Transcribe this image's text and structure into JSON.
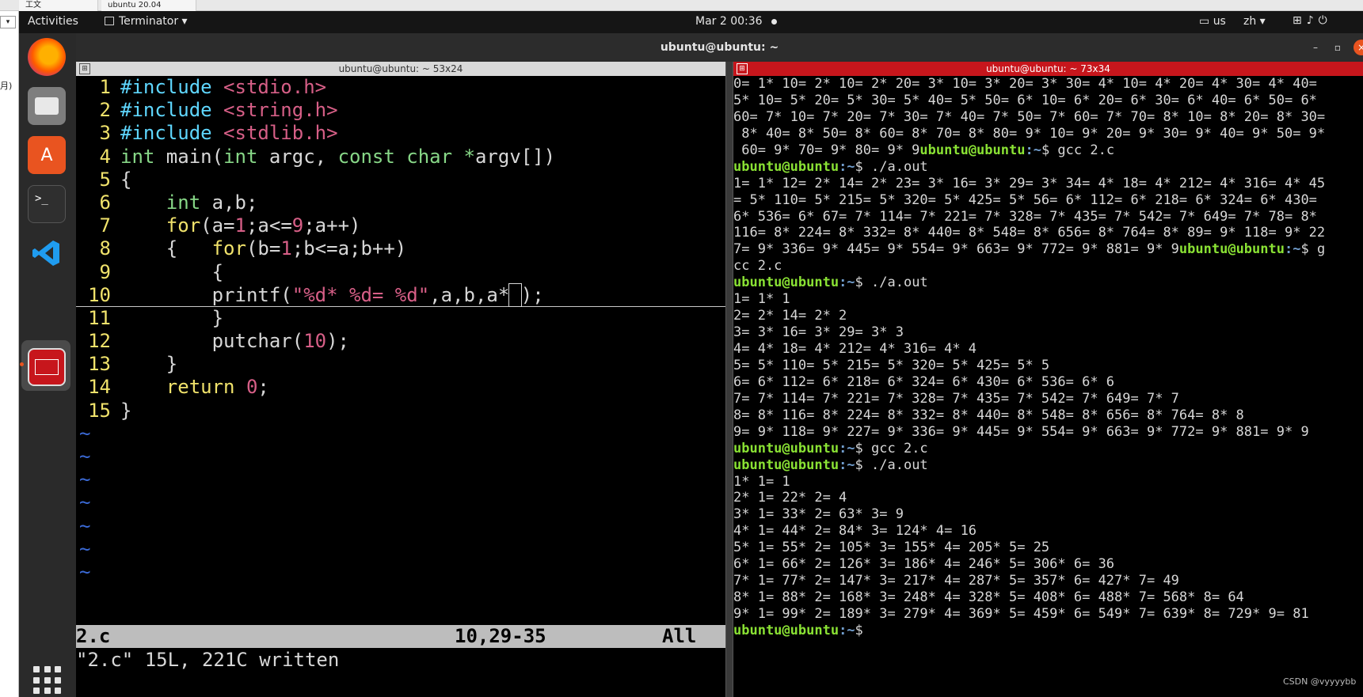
{
  "host": {
    "tab1": "工文",
    "tab2": "ubuntu 20.04",
    "dropdown": "▾",
    "side_label": "月)"
  },
  "topbar": {
    "activities": "Activities",
    "app_menu": "Terminator ▾",
    "clock": "Mar 2  00:36",
    "keyboard": "us",
    "input_method": "zh ▾"
  },
  "window": {
    "title": "ubuntu@ubuntu: ~"
  },
  "left_pane": {
    "title": "ubuntu@ubuntu: ~ 53x24",
    "status_file": "2.c",
    "status_pos": "10,29-35",
    "status_all": "All",
    "cmdline": "\"2.c\" 15L, 221C written"
  },
  "right_pane": {
    "title": "ubuntu@ubuntu: ~ 73x34",
    "lines": [
      {
        "text": "0= 1* 10= 2* 10= 2* 20= 3* 10= 3* 20= 3* 30= 4* 10= 4* 20= 4* 30= 4* 40="
      },
      {
        "text": "5* 10= 5* 20= 5* 30= 5* 40= 5* 50= 6* 10= 6* 20= 6* 30= 6* 40= 6* 50= 6*"
      },
      {
        "text": "60= 7* 10= 7* 20= 7* 30= 7* 40= 7* 50= 7* 60= 7* 70= 8* 10= 8* 20= 8* 30="
      },
      {
        "text": " 8* 40= 8* 50= 8* 60= 8* 70= 8* 80= 9* 10= 9* 20= 9* 30= 9* 40= 9* 50= 9*"
      },
      {
        "pre": " 60= 9* 70= 9* 80= 9* 9",
        "user": "ubuntu@ubuntu",
        "path": ":~",
        "cmd": "$ gcc 2.c"
      },
      {
        "user": "ubuntu@ubuntu",
        "path": ":~",
        "cmd": "$ ./a.out"
      },
      {
        "text": "1= 1* 12= 2* 14= 2* 23= 3* 16= 3* 29= 3* 34= 4* 18= 4* 212= 4* 316= 4* 45"
      },
      {
        "text": "= 5* 110= 5* 215= 5* 320= 5* 425= 5* 56= 6* 112= 6* 218= 6* 324= 6* 430="
      },
      {
        "text": "6* 536= 6* 67= 7* 114= 7* 221= 7* 328= 7* 435= 7* 542= 7* 649= 7* 78= 8*"
      },
      {
        "text": "116= 8* 224= 8* 332= 8* 440= 8* 548= 8* 656= 8* 764= 8* 89= 9* 118= 9* 22"
      },
      {
        "pre": "7= 9* 336= 9* 445= 9* 554= 9* 663= 9* 772= 9* 881= 9* 9",
        "user": "ubuntu@ubuntu",
        "path": ":~",
        "cmd": "$ g"
      },
      {
        "text": "cc 2.c"
      },
      {
        "user": "ubuntu@ubuntu",
        "path": ":~",
        "cmd": "$ ./a.out"
      },
      {
        "text": "1= 1* 1"
      },
      {
        "text": "2= 2* 14= 2* 2"
      },
      {
        "text": "3= 3* 16= 3* 29= 3* 3"
      },
      {
        "text": "4= 4* 18= 4* 212= 4* 316= 4* 4"
      },
      {
        "text": "5= 5* 110= 5* 215= 5* 320= 5* 425= 5* 5"
      },
      {
        "text": "6= 6* 112= 6* 218= 6* 324= 6* 430= 6* 536= 6* 6"
      },
      {
        "text": "7= 7* 114= 7* 221= 7* 328= 7* 435= 7* 542= 7* 649= 7* 7"
      },
      {
        "text": "8= 8* 116= 8* 224= 8* 332= 8* 440= 8* 548= 8* 656= 8* 764= 8* 8"
      },
      {
        "text": "9= 9* 118= 9* 227= 9* 336= 9* 445= 9* 554= 9* 663= 9* 772= 9* 881= 9* 9"
      },
      {
        "user": "ubuntu@ubuntu",
        "path": ":~",
        "cmd": "$ gcc 2.c"
      },
      {
        "user": "ubuntu@ubuntu",
        "path": ":~",
        "cmd": "$ ./a.out"
      },
      {
        "text": "1* 1= 1"
      },
      {
        "text": "2* 1= 22* 2= 4"
      },
      {
        "text": "3* 1= 33* 2= 63* 3= 9"
      },
      {
        "text": "4* 1= 44* 2= 84* 3= 124* 4= 16"
      },
      {
        "text": "5* 1= 55* 2= 105* 3= 155* 4= 205* 5= 25"
      },
      {
        "text": "6* 1= 66* 2= 126* 3= 186* 4= 246* 5= 306* 6= 36"
      },
      {
        "text": "7* 1= 77* 2= 147* 3= 217* 4= 287* 5= 357* 6= 427* 7= 49"
      },
      {
        "text": "8* 1= 88* 2= 168* 3= 248* 4= 328* 5= 408* 6= 488* 7= 568* 8= 64"
      },
      {
        "text": "9* 1= 99* 2= 189* 3= 279* 4= 369* 5= 459* 6= 549* 7= 639* 8= 729* 9= 81"
      },
      {
        "user": "ubuntu@ubuntu",
        "path": ":~",
        "cmd": "$ "
      }
    ]
  },
  "code": [
    {
      "n": "1",
      "parts": [
        [
          "pre",
          "#include "
        ],
        [
          "ang",
          "<stdio.h>"
        ]
      ]
    },
    {
      "n": "2",
      "parts": [
        [
          "pre",
          "#include "
        ],
        [
          "ang",
          "<string.h>"
        ]
      ]
    },
    {
      "n": "3",
      "parts": [
        [
          "pre",
          "#include "
        ],
        [
          "ang",
          "<stdlib.h>"
        ]
      ]
    },
    {
      "n": "4",
      "parts": [
        [
          "ty",
          "int"
        ],
        [
          "pl",
          " main("
        ],
        [
          "ty",
          "int"
        ],
        [
          "pl",
          " argc, "
        ],
        [
          "ty",
          "const"
        ],
        [
          "pl",
          " "
        ],
        [
          "ty",
          "char"
        ],
        [
          "pl",
          " "
        ],
        [
          "ty",
          "*"
        ],
        [
          "pl",
          "argv[])"
        ]
      ]
    },
    {
      "n": "5",
      "parts": [
        [
          "pl",
          "{"
        ]
      ]
    },
    {
      "n": "6",
      "parts": [
        [
          "pl",
          "    "
        ],
        [
          "ty",
          "int"
        ],
        [
          "pl",
          " a,b;"
        ]
      ]
    },
    {
      "n": "7",
      "parts": [
        [
          "pl",
          "    "
        ],
        [
          "stm",
          "for"
        ],
        [
          "pl",
          "(a="
        ],
        [
          "num",
          "1"
        ],
        [
          "pl",
          ";a<="
        ],
        [
          "num",
          "9"
        ],
        [
          "pl",
          ";a++)"
        ]
      ]
    },
    {
      "n": "8",
      "parts": [
        [
          "pl",
          "    {   "
        ],
        [
          "stm",
          "for"
        ],
        [
          "pl",
          "(b="
        ],
        [
          "num",
          "1"
        ],
        [
          "pl",
          ";b<=a;b++)"
        ]
      ]
    },
    {
      "n": "9",
      "parts": [
        [
          "pl",
          "        {"
        ]
      ]
    },
    {
      "n": "10",
      "cursorline": true,
      "parts": [
        [
          "pl",
          "        printf("
        ],
        [
          "str",
          "\"%d* %d= %d\""
        ],
        [
          "pl",
          ",a,b,a*"
        ],
        [
          "cur",
          "b"
        ],
        [
          "pl",
          ");"
        ]
      ]
    },
    {
      "n": "11",
      "parts": [
        [
          "pl",
          "        }"
        ]
      ]
    },
    {
      "n": "12",
      "parts": [
        [
          "pl",
          "        putchar("
        ],
        [
          "num",
          "10"
        ],
        [
          "pl",
          ");"
        ]
      ]
    },
    {
      "n": "13",
      "parts": [
        [
          "pl",
          "    }"
        ]
      ]
    },
    {
      "n": "14",
      "parts": [
        [
          "pl",
          "    "
        ],
        [
          "stm",
          "return"
        ],
        [
          "pl",
          " "
        ],
        [
          "num",
          "0"
        ],
        [
          "pl",
          ";"
        ]
      ]
    },
    {
      "n": "15",
      "parts": [
        [
          "pl",
          "}"
        ]
      ]
    }
  ],
  "tildes": [
    "~",
    "~",
    "~",
    "~",
    "~",
    "~",
    "~"
  ],
  "watermark": "CSDN @vyyyybb"
}
